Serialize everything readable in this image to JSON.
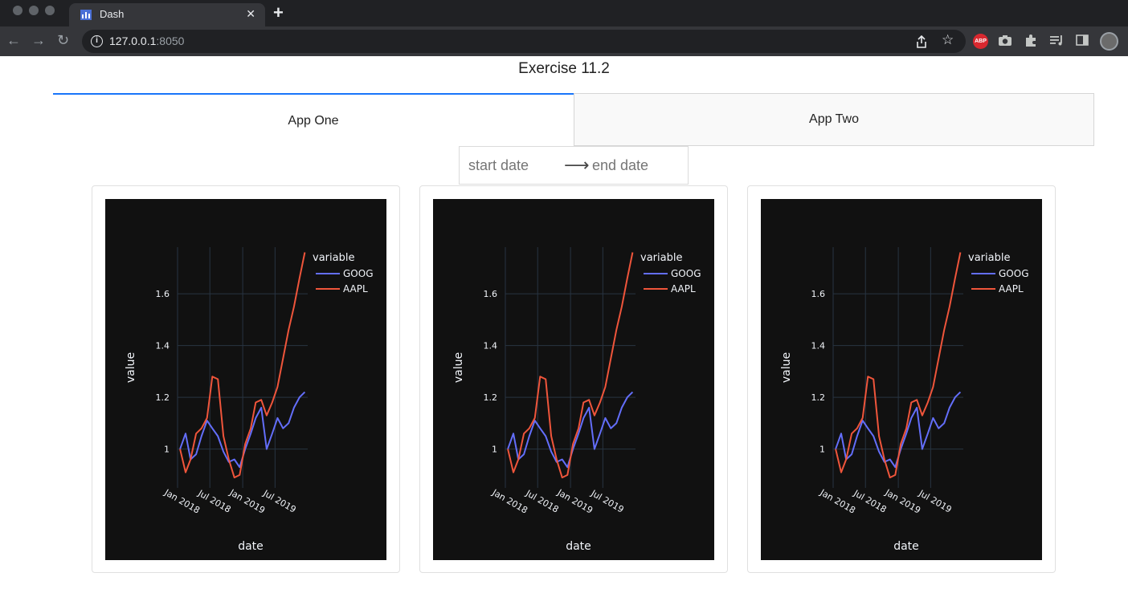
{
  "browser": {
    "tab_title": "Dash",
    "close_glyph": "✕",
    "new_tab_glyph": "+",
    "url_host": "127.0.0.1",
    "url_port": ":8050",
    "ext_abp_label": "ABP"
  },
  "page": {
    "title": "Exercise 11.2",
    "tabs": [
      {
        "label": "App One",
        "selected": true
      },
      {
        "label": "App Two",
        "selected": false
      }
    ],
    "date_range": {
      "start_placeholder": "start date",
      "end_placeholder": "end date",
      "arrow": "⟶"
    }
  },
  "colors": {
    "tab_accent": "#1975fa",
    "plot_bg": "#111111",
    "goog": "#636efa",
    "aapl": "#ef553b"
  },
  "chart_data": [
    {
      "type": "line",
      "xlabel": "date",
      "ylabel": "value",
      "legend_title": "variable",
      "legend_position": "top-right",
      "grid": true,
      "x_ticks": [
        "Jan 2018",
        "Jul 2018",
        "Jan 2019",
        "Jul 2019"
      ],
      "y_ticks": [
        "1",
        "1.2",
        "1.4",
        "1.6"
      ],
      "ylim": [
        0.85,
        1.78
      ],
      "x_range": [
        "2018-01-01",
        "2019-12-31"
      ],
      "x": [
        "2018-01",
        "2018-02",
        "2018-03",
        "2018-04",
        "2018-05",
        "2018-06",
        "2018-07",
        "2018-08",
        "2018-09",
        "2018-10",
        "2018-11",
        "2018-12",
        "2019-01",
        "2019-02",
        "2019-03",
        "2019-04",
        "2019-05",
        "2019-06",
        "2019-07",
        "2019-08",
        "2019-09",
        "2019-10",
        "2019-11",
        "2019-12"
      ],
      "series": [
        {
          "name": "GOOG",
          "values": [
            1.0,
            1.06,
            0.96,
            0.98,
            1.05,
            1.11,
            1.08,
            1.05,
            0.99,
            0.95,
            0.96,
            0.93,
            1.0,
            1.06,
            1.12,
            1.16,
            1.0,
            1.06,
            1.12,
            1.08,
            1.1,
            1.16,
            1.2,
            1.22
          ]
        },
        {
          "name": "AAPL",
          "values": [
            1.0,
            0.91,
            0.96,
            1.06,
            1.08,
            1.12,
            1.28,
            1.27,
            1.05,
            0.96,
            0.89,
            0.9,
            1.02,
            1.08,
            1.18,
            1.19,
            1.13,
            1.18,
            1.24,
            1.35,
            1.46,
            1.55,
            1.66,
            1.76
          ]
        }
      ]
    },
    {
      "type": "line",
      "xlabel": "date",
      "ylabel": "value",
      "legend_title": "variable",
      "legend_position": "top-right",
      "grid": true,
      "x_ticks": [
        "Jan 2018",
        "Jul 2018",
        "Jan 2019",
        "Jul 2019"
      ],
      "y_ticks": [
        "1",
        "1.2",
        "1.4",
        "1.6"
      ],
      "ylim": [
        0.85,
        1.78
      ],
      "x_range": [
        "2018-01-01",
        "2019-12-31"
      ],
      "x": [
        "2018-01",
        "2018-02",
        "2018-03",
        "2018-04",
        "2018-05",
        "2018-06",
        "2018-07",
        "2018-08",
        "2018-09",
        "2018-10",
        "2018-11",
        "2018-12",
        "2019-01",
        "2019-02",
        "2019-03",
        "2019-04",
        "2019-05",
        "2019-06",
        "2019-07",
        "2019-08",
        "2019-09",
        "2019-10",
        "2019-11",
        "2019-12"
      ],
      "series": [
        {
          "name": "GOOG",
          "values": [
            1.0,
            1.06,
            0.96,
            0.98,
            1.05,
            1.11,
            1.08,
            1.05,
            0.99,
            0.95,
            0.96,
            0.93,
            1.0,
            1.06,
            1.12,
            1.16,
            1.0,
            1.06,
            1.12,
            1.08,
            1.1,
            1.16,
            1.2,
            1.22
          ]
        },
        {
          "name": "AAPL",
          "values": [
            1.0,
            0.91,
            0.96,
            1.06,
            1.08,
            1.12,
            1.28,
            1.27,
            1.05,
            0.96,
            0.89,
            0.9,
            1.02,
            1.08,
            1.18,
            1.19,
            1.13,
            1.18,
            1.24,
            1.35,
            1.46,
            1.55,
            1.66,
            1.76
          ]
        }
      ]
    },
    {
      "type": "line",
      "xlabel": "date",
      "ylabel": "value",
      "legend_title": "variable",
      "legend_position": "top-right",
      "grid": true,
      "x_ticks": [
        "Jan 2018",
        "Jul 2018",
        "Jan 2019",
        "Jul 2019"
      ],
      "y_ticks": [
        "1",
        "1.2",
        "1.4",
        "1.6"
      ],
      "ylim": [
        0.85,
        1.78
      ],
      "x_range": [
        "2018-01-01",
        "2019-12-31"
      ],
      "x": [
        "2018-01",
        "2018-02",
        "2018-03",
        "2018-04",
        "2018-05",
        "2018-06",
        "2018-07",
        "2018-08",
        "2018-09",
        "2018-10",
        "2018-11",
        "2018-12",
        "2019-01",
        "2019-02",
        "2019-03",
        "2019-04",
        "2019-05",
        "2019-06",
        "2019-07",
        "2019-08",
        "2019-09",
        "2019-10",
        "2019-11",
        "2019-12"
      ],
      "series": [
        {
          "name": "GOOG",
          "values": [
            1.0,
            1.06,
            0.96,
            0.98,
            1.05,
            1.11,
            1.08,
            1.05,
            0.99,
            0.95,
            0.96,
            0.93,
            1.0,
            1.06,
            1.12,
            1.16,
            1.0,
            1.06,
            1.12,
            1.08,
            1.1,
            1.16,
            1.2,
            1.22
          ]
        },
        {
          "name": "AAPL",
          "values": [
            1.0,
            0.91,
            0.96,
            1.06,
            1.08,
            1.12,
            1.28,
            1.27,
            1.05,
            0.96,
            0.89,
            0.9,
            1.02,
            1.08,
            1.18,
            1.19,
            1.13,
            1.18,
            1.24,
            1.35,
            1.46,
            1.55,
            1.66,
            1.76
          ]
        }
      ]
    }
  ]
}
